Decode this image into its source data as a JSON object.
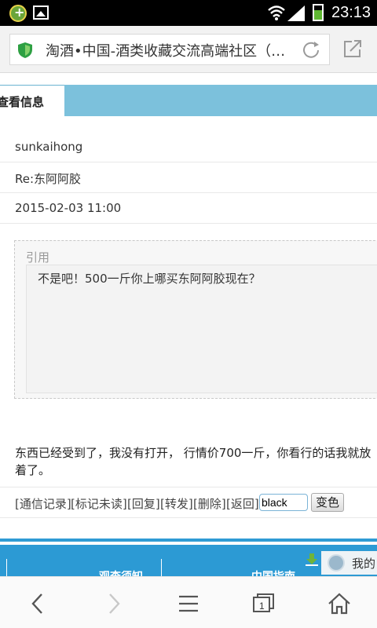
{
  "status_bar": {
    "time": "23:13",
    "icons": [
      "app-notification-icon",
      "image-notification-icon",
      "wifi-icon",
      "signal-icon",
      "battery-charging-icon"
    ]
  },
  "browser": {
    "url_title": "淘酒•中国-酒类收藏交流高端社区（专…",
    "icons": [
      "security-shield-icon",
      "reload-icon",
      "share-icon"
    ]
  },
  "page": {
    "tab_label": "查看信息",
    "sender": "sunkaihong",
    "subject": "Re:东阿阿胶",
    "date": "2015-02-03 11:00",
    "quote": {
      "label": "引用",
      "text": "不是吧！500一斤你上哪买东阿阿胶现在？"
    },
    "message": "东西已经受到了，我没有打开，  行情价700一斤，你看行的话我就放着了。",
    "actions": {
      "history": "[通信记录]",
      "mark_unread": "[标记未读]",
      "reply": "[回复]",
      "forward": "[转发]",
      "delete": "[删除]",
      "back": "[返回]",
      "color_value": "black",
      "color_button": "变色"
    }
  },
  "footer": {
    "left_label": "观查须知",
    "right_label": "中国指南",
    "extra_label": "我的"
  },
  "nav": {
    "icons": [
      "back-icon",
      "forward-icon",
      "menu-icon",
      "tabs-icon",
      "home-icon"
    ],
    "tab_count": "1"
  }
}
